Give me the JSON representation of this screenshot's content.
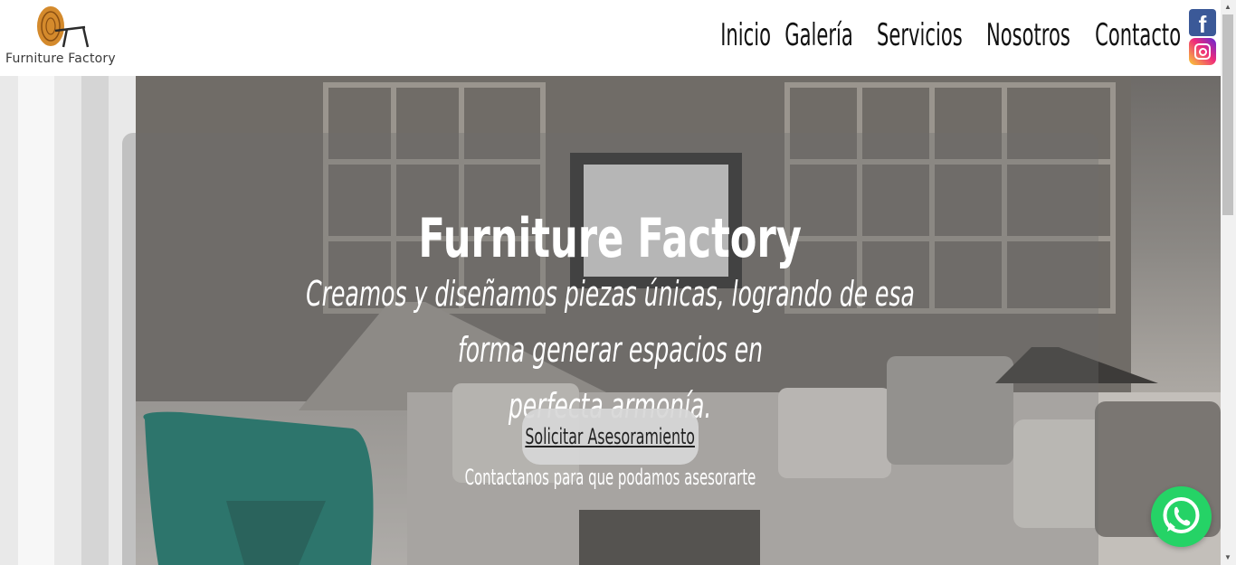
{
  "brand": {
    "name": "Furniture Factory",
    "logo_icon": "chair-wood-icon"
  },
  "nav": {
    "items": [
      "Inicio",
      "Galería",
      "Servicios",
      "Nosotros",
      "Contacto"
    ]
  },
  "social": {
    "facebook_icon": "facebook-icon",
    "instagram_icon": "instagram-icon"
  },
  "hero": {
    "title": "Furniture Factory",
    "subtitle_line1": "Creamos y diseñamos piezas únicas, logrando de esa forma generar espacios en",
    "subtitle_line2": "perfecta armonía.",
    "cta_label": "Solicitar Asesoramiento",
    "cta_note": "Contactanos para que podamos asesorarte"
  },
  "whatsapp": {
    "icon": "whatsapp-icon",
    "color": "#25d366"
  },
  "colors": {
    "facebook": "#3b5998",
    "chair_accent": "#0f7a6c"
  }
}
